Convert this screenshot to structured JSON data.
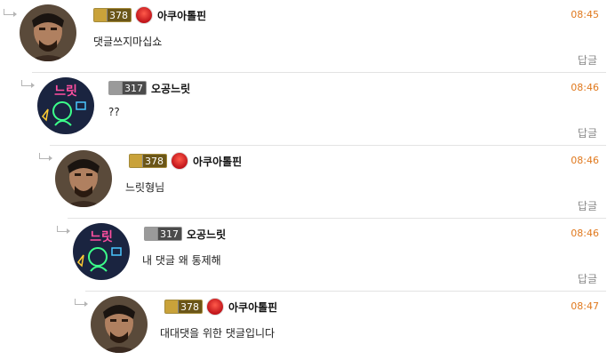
{
  "comments": [
    {
      "level": "378",
      "nickname": "아쿠아톨핀",
      "time": "08:45",
      "text": "댓글쓰지마십쇼",
      "reply_label": "답글"
    },
    {
      "level": "317",
      "nickname": "오공느릿",
      "time": "08:46",
      "text": "??",
      "reply_label": "답글"
    },
    {
      "level": "378",
      "nickname": "아쿠아톨핀",
      "time": "08:46",
      "text": "느릿형님",
      "reply_label": "답글"
    },
    {
      "level": "317",
      "nickname": "오공느릿",
      "time": "08:46",
      "text": "내 댓글 왜 통제해",
      "reply_label": "답글"
    },
    {
      "level": "378",
      "nickname": "아쿠아톨핀",
      "time": "08:47",
      "text": "대대댓을 위한 댓글입니다"
    }
  ],
  "avatar_neon_text": "느릿"
}
